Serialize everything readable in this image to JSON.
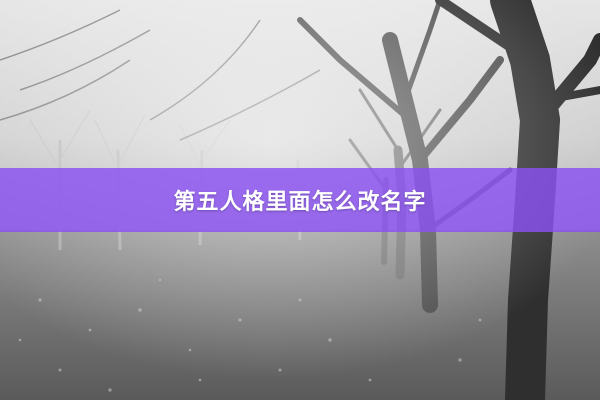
{
  "banner": {
    "title": "第五人格里面怎么改名字",
    "color": "#8a50f0"
  },
  "photo": {
    "style": "grayscale"
  }
}
